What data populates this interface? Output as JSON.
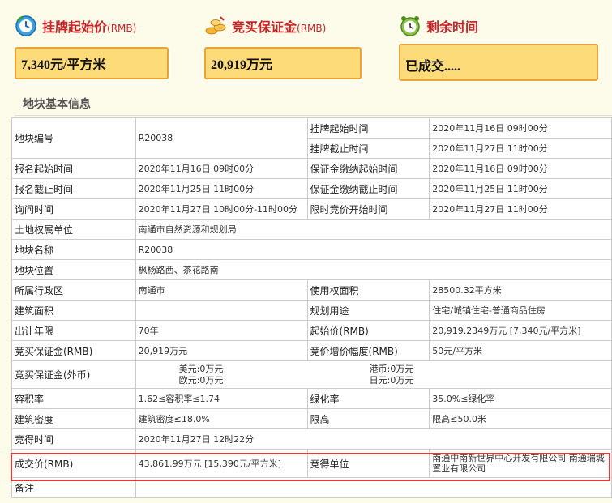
{
  "cards": {
    "start_price": {
      "label": "挂牌起始价",
      "unit": "(RMB)",
      "value": "7,340元/平方米",
      "icon": "clock-refresh-icon"
    },
    "deposit": {
      "label": "竞买保证金",
      "unit": "(RMB)",
      "value": "20,919万元",
      "icon": "coins-icon"
    },
    "remaining": {
      "label": "剩余时间",
      "value": "已成交.....",
      "icon": "alarm-clock-icon"
    }
  },
  "section_title": "地块基本信息",
  "rows": {
    "r1": {
      "l1": "地块编号",
      "v1": "R20038",
      "l2a": "挂牌起始时间",
      "v2a": "2020年11月16日 09时00分",
      "l2b": "挂牌截止时间",
      "v2b": "2020年11月27日 11时00分"
    },
    "r2": {
      "l1": "报名起始时间",
      "v1": "2020年11月16日 09时00分",
      "l2": "保证金缴纳起始时间",
      "v2": "2020年11月16日 09时00分"
    },
    "r3": {
      "l1": "报名截止时间",
      "v1": "2020年11月25日 11时00分",
      "l2": "保证金缴纳截止时间",
      "v2": "2020年11月25日 11时00分"
    },
    "r4": {
      "l1": "询问时间",
      "v1": "2020年11月27日 10时00分-11时00分",
      "l2": "限时竞价开始时间",
      "v2": "2020年11月27日 11时00分"
    },
    "r5": {
      "l1": "土地权属单位",
      "v1": "南通市自然资源和规划局"
    },
    "r6": {
      "l1": "地块名称",
      "v1": "R20038"
    },
    "r7": {
      "l1": "地块位置",
      "v1": "枫杨路西、茶花路南"
    },
    "r8": {
      "l1": "所属行政区",
      "v1": "南通市",
      "l2": "使用权面积",
      "v2": "28500.32平方米"
    },
    "r9": {
      "l1": "建筑面积",
      "v1": "",
      "l2": "规划用途",
      "v2": "住宅/城镇住宅-普通商品住房"
    },
    "r10": {
      "l1": "出让年限",
      "v1": "70年",
      "l2": "起始价(RMB)",
      "v2": "20,919.2349万元 [7,340元/平方米]"
    },
    "r11": {
      "l1": "竞买保证金(RMB)",
      "v1": "20,919万元",
      "l2": "竞价增价幅度(RMB)",
      "v2": "50元/平方米"
    },
    "r12": {
      "l1": "竞买保证金(外币)",
      "usd": "美元:0万元",
      "hkd": "港币:0万元",
      "eur": "欧元:0万元",
      "jpy": "日元:0万元"
    },
    "r13": {
      "l1": "容积率",
      "v1": "1.62≤容积率≤1.74",
      "l2": "绿化率",
      "v2": "35.0%≤绿化率"
    },
    "r14": {
      "l1": "建筑密度",
      "v1": "建筑密度≤18.0%",
      "l2": "限高",
      "v2": "限高≤50.0米"
    },
    "r15": {
      "l1": "竞得时间",
      "v1": "2020年11月27日 12时22分"
    },
    "r16": {
      "l1": "成交价(RMB)",
      "v1": "43,861.99万元 [15,390元/平方米]",
      "l2": "竞得单位",
      "v2": "南通中南新世界中心开发有限公司 南通瑞城置业有限公司"
    },
    "r17": {
      "l1": "备注",
      "v1": ""
    }
  },
  "colors": {
    "accent_red": "#c8262a",
    "card_fill": "#fcdb78",
    "card_border": "#e8a33b",
    "highlight": "#e03b3b"
  }
}
